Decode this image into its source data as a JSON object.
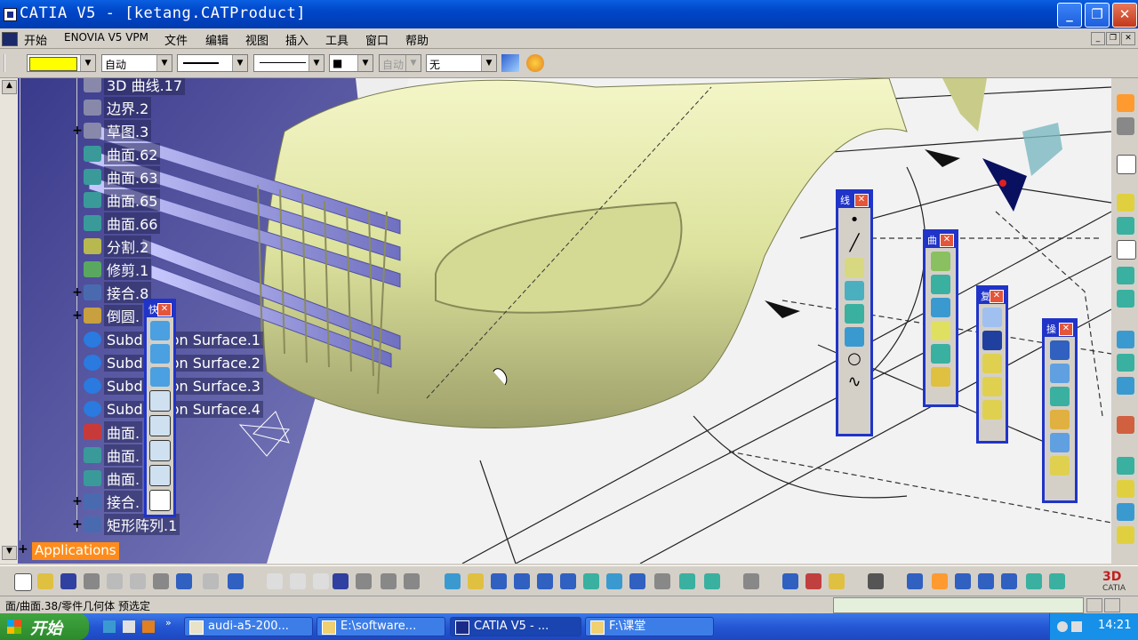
{
  "window": {
    "title": "CATIA V5 - [ketang.CATProduct]",
    "minimize": "_",
    "maximize": "❐",
    "close": "✕"
  },
  "menubar": {
    "items": [
      "开始",
      "ENOVIA V5 VPM",
      "文件",
      "编辑",
      "视图",
      "插入",
      "工具",
      "窗口",
      "帮助"
    ],
    "mdi_min": "_",
    "mdi_restore": "❐",
    "mdi_close": "✕"
  },
  "graphic_properties": {
    "color_value": "",
    "transparency": "自动",
    "linetype_sample": "",
    "thickness_sample": "",
    "point_symbol": "■",
    "layer_disabled": "自动",
    "layer": "无",
    "color_hex": "#ffff00"
  },
  "tree": {
    "nodes": [
      {
        "label": "3D 曲线.17",
        "icon": "curve-icon",
        "expand": "",
        "color": "#8888aa"
      },
      {
        "label": "边界.2",
        "icon": "boundary-icon",
        "expand": "",
        "color": "#8888aa"
      },
      {
        "label": "草图.3",
        "icon": "sketch-icon",
        "expand": "+",
        "color": "#8888aa"
      },
      {
        "label": "曲面.62",
        "icon": "surface-icon",
        "expand": "",
        "color": "#3a9a9a"
      },
      {
        "label": "曲面.63",
        "icon": "surface-icon",
        "expand": "",
        "color": "#3a9a9a"
      },
      {
        "label": "曲面.65",
        "icon": "surface-icon",
        "expand": "",
        "color": "#3a9a9a"
      },
      {
        "label": "曲面.66",
        "icon": "surface-icon",
        "expand": "",
        "color": "#3a9a9a"
      },
      {
        "label": "分割.2",
        "icon": "split-icon",
        "expand": "",
        "color": "#b8b850"
      },
      {
        "label": "修剪.1",
        "icon": "trim-icon",
        "expand": "",
        "color": "#5aa860"
      },
      {
        "label": "接合.8",
        "icon": "join-icon",
        "expand": "+",
        "color": "#4a6ab0"
      },
      {
        "label": "倒圆.",
        "icon": "fillet-icon",
        "expand": "+",
        "color": "#c8a040"
      },
      {
        "label": "Subdivision Surface.1",
        "icon": "subdivision-icon",
        "expand": "",
        "color": "#2a7ae0"
      },
      {
        "label": "Subdivision Surface.2",
        "icon": "subdivision-icon",
        "expand": "",
        "color": "#2a7ae0"
      },
      {
        "label": "Subdivision Surface.3",
        "icon": "subdivision-icon",
        "expand": "",
        "color": "#2a7ae0"
      },
      {
        "label": "Subdivision Surface.4",
        "icon": "subdivision-icon",
        "expand": "",
        "color": "#2a7ae0"
      },
      {
        "label": "曲面.",
        "icon": "surface-icon",
        "expand": "",
        "color": "#c83a3a"
      },
      {
        "label": "曲面.",
        "icon": "surface-icon",
        "expand": "",
        "color": "#3a9a9a"
      },
      {
        "label": "曲面.",
        "icon": "surface-icon",
        "expand": "",
        "color": "#3a9a9a"
      },
      {
        "label": "接合.",
        "icon": "join-icon",
        "expand": "+",
        "color": "#4a6ab0"
      },
      {
        "label": "矩形阵列.1",
        "icon": "pattern-icon",
        "expand": "+",
        "color": "#4a6ab0"
      }
    ],
    "applications": "Applications"
  },
  "palettes": {
    "quick": {
      "title": "快"
    },
    "line": {
      "title": "线"
    },
    "curve": {
      "title": "曲"
    },
    "copy": {
      "title": "复"
    },
    "operation": {
      "title": "操"
    }
  },
  "status": {
    "text": "面/曲面.38/零件几何体 预选定"
  },
  "taskbar": {
    "start": "开始",
    "tasks": [
      "audi-a5-200...",
      "E:\\software...",
      "CATIA V5 - ...",
      "F:\\课堂"
    ],
    "clock": "14:21"
  },
  "colors": {
    "palette_border": "#2034c8",
    "body_color": "#e3e6a8",
    "tree_background": "#4a4a9c",
    "applications_bg": "#ff8c1a"
  }
}
